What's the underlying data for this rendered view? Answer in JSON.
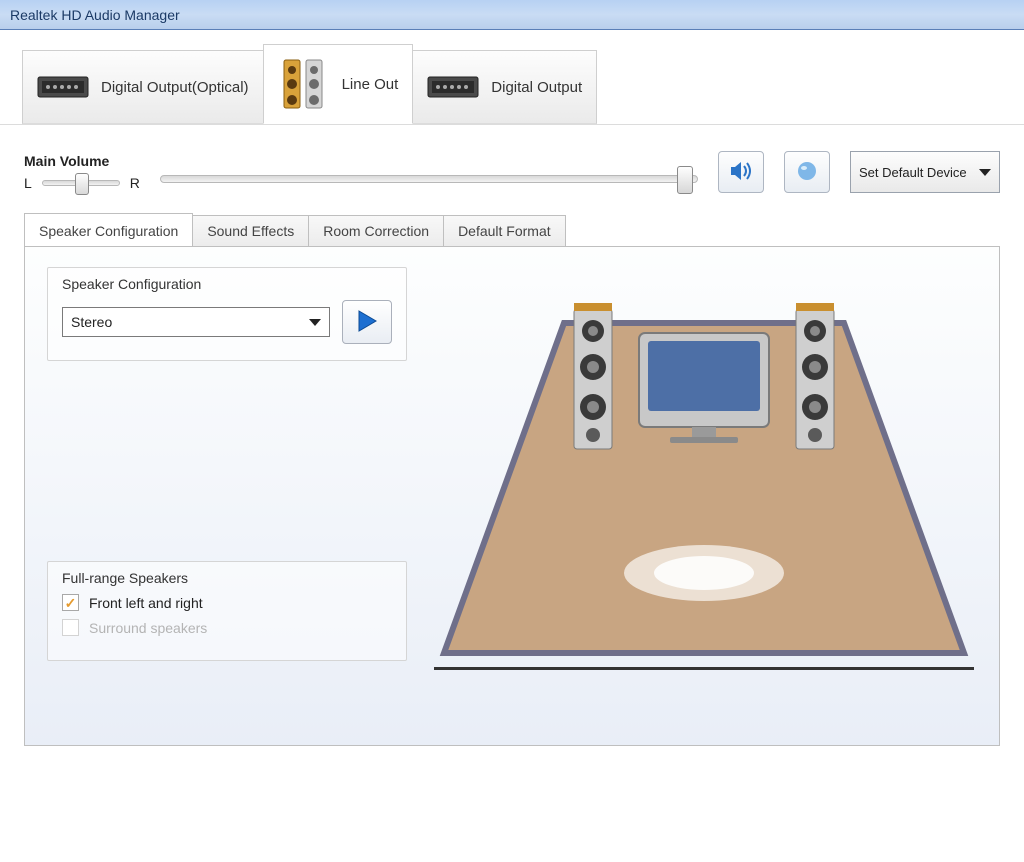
{
  "window": {
    "title": "Realtek HD Audio Manager"
  },
  "outputTabs": {
    "items": [
      {
        "label": "Digital Output(Optical)"
      },
      {
        "label": "Line Out"
      },
      {
        "label": "Digital Output"
      }
    ],
    "activeIndex": 1
  },
  "volume": {
    "heading": "Main Volume",
    "balanceLeft": "L",
    "balanceRight": "R"
  },
  "defaultDeviceButton": "Set Default Device",
  "innerTabs": {
    "items": [
      {
        "label": "Speaker Configuration"
      },
      {
        "label": "Sound Effects"
      },
      {
        "label": "Room Correction"
      },
      {
        "label": "Default Format"
      }
    ],
    "activeIndex": 0
  },
  "speakerConfig": {
    "groupTitle": "Speaker Configuration",
    "selected": "Stereo"
  },
  "fullRange": {
    "groupTitle": "Full-range Speakers",
    "frontLabel": "Front left and right",
    "surroundLabel": "Surround speakers",
    "frontChecked": true,
    "surroundEnabled": false
  }
}
